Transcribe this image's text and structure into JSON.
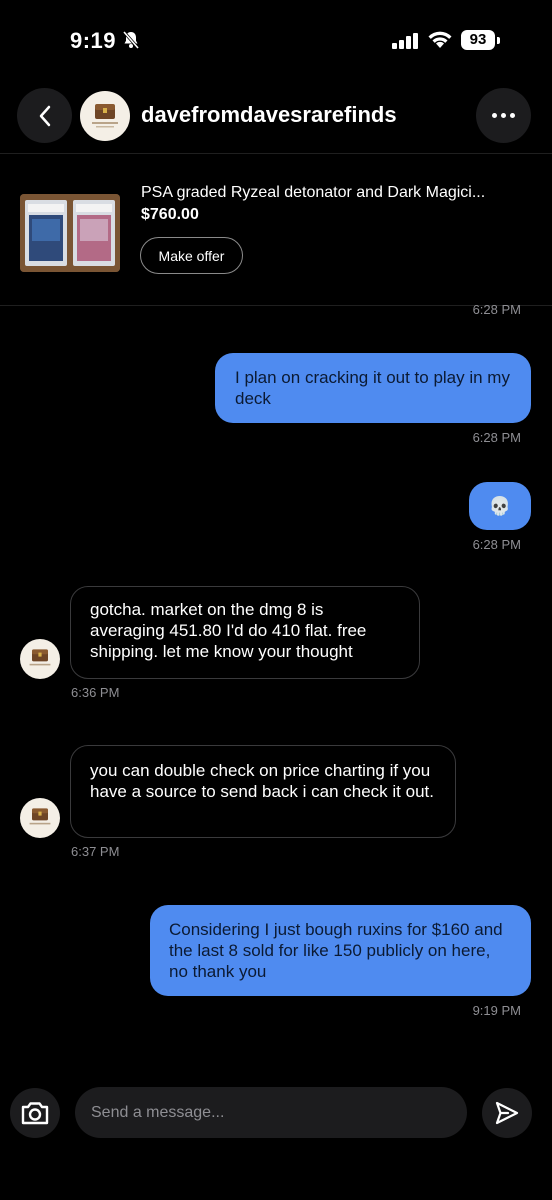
{
  "status_bar": {
    "time": "9:19",
    "battery": "93"
  },
  "header": {
    "username": "davefromdavesrarefinds"
  },
  "listing": {
    "title": "PSA graded Ryzeal detonator and Dark Magici...",
    "price": "$760.00",
    "offer_label": "Make offer"
  },
  "messages": [
    {
      "timestamp": "6:28 PM"
    },
    {
      "text": "I plan on cracking it out to play in my deck",
      "timestamp": "6:28 PM"
    },
    {
      "text": "💀",
      "timestamp": "6:28 PM"
    },
    {
      "text": "gotcha.  market on the dmg 8 is averaging 451.80  I'd do 410 flat.  free shipping. let me know your thought",
      "timestamp": "6:36 PM"
    },
    {
      "text": "you can double check on price charting if you have a source to send back i can check it out.",
      "timestamp": "6:37 PM"
    },
    {
      "text": "Considering I just bough ruxins for $160 and the last 8 sold for like 150 publicly on here, no thank you",
      "timestamp": "9:19 PM"
    }
  ],
  "composer": {
    "placeholder": "Send a message..."
  },
  "colors": {
    "outgoing_bubble": "#4f8bf0",
    "background": "#000000",
    "button_bg": "#1c1c1e"
  }
}
